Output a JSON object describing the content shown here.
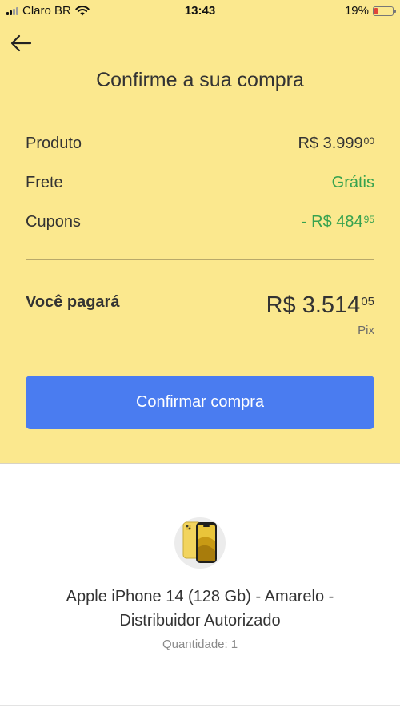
{
  "status_bar": {
    "carrier": "Claro BR",
    "time": "13:43",
    "battery": "19%",
    "battery_color": "#e0463a"
  },
  "header": {
    "back_icon": "arrow-left-icon",
    "title": "Confirme a sua compra"
  },
  "summary": {
    "rows": [
      {
        "label": "Produto",
        "value": "R$ 3.999",
        "cents": "00"
      },
      {
        "label": "Frete",
        "value": "Grátis",
        "cents": ""
      },
      {
        "label": "Cupons",
        "value": "- R$ 484",
        "cents": "95"
      }
    ],
    "total_label": "Você pagará",
    "total_value": "R$ 3.514",
    "total_cents": "05",
    "payment_method": "Pix"
  },
  "confirm_button": {
    "label": "Confirmar compra",
    "color": "#4a7cf0"
  },
  "product": {
    "name": "Apple iPhone 14 (128 Gb) - Amarelo - Distribuidor Autorizado",
    "quantity_label": "Quantidade:",
    "quantity": "1",
    "image_icon": "iphone-yellow-thumbnail"
  },
  "colors": {
    "background_top": "#fbe88e",
    "accent_green": "#36a24f"
  }
}
